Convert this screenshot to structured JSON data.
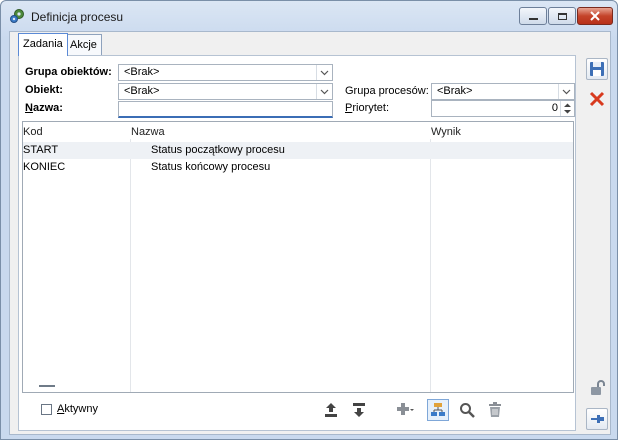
{
  "window": {
    "title": "Definicja procesu"
  },
  "tabs": [
    {
      "label": "Zadania"
    },
    {
      "label": "Akcje"
    }
  ],
  "filters": {
    "grupa_obiektow": {
      "label": "Grupa obiektów:",
      "value": "<Brak>"
    },
    "obiekt": {
      "label": "Obiekt:",
      "value": "<Brak>"
    },
    "nazwa": {
      "label_underline": "N",
      "label_rest": "azwa:",
      "value": ""
    },
    "grupa_procesow": {
      "label": "Grupa procesów:",
      "value": "<Brak>"
    },
    "priorytet": {
      "label_underline": "P",
      "label_rest": "riorytet:",
      "value": "0"
    }
  },
  "grid": {
    "columns": [
      "Kod",
      "Nazwa",
      "Wynik"
    ],
    "rows": [
      {
        "kod": "START",
        "nazwa": "Status początkowy procesu",
        "wynik": ""
      },
      {
        "kod": "KONIEC",
        "nazwa": "Status końcowy procesu",
        "wynik": ""
      }
    ]
  },
  "footer": {
    "aktywny_underline": "A",
    "aktywny_rest": "ktywny",
    "aktywny_checked": false
  },
  "icons": {
    "save": "floppy-icon",
    "cancel": "cancel-x-icon",
    "lock": "unlock-icon",
    "pin": "pin-icon",
    "export": "export-icon",
    "import": "import-icon",
    "add": "plus-icon",
    "structure": "structure-icon",
    "search": "magnifier-icon",
    "delete": "trash-icon"
  },
  "colors": {
    "accent": "#5b8ad6",
    "close": "#c4432a",
    "cancel_x": "#d83a1e"
  }
}
